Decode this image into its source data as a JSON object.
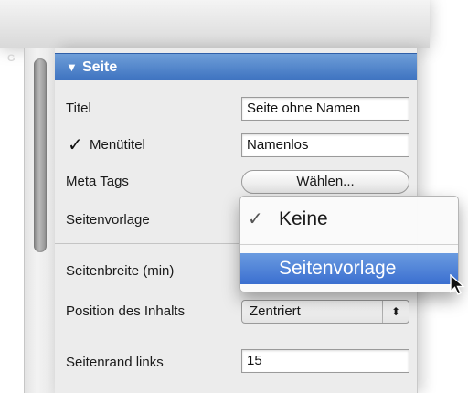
{
  "ghost_tab": "G",
  "section": {
    "title": "Seite",
    "toggle_icon": "disclosure-triangle-down"
  },
  "rows": {
    "titel_label": "Titel",
    "titel_value": "Seite ohne Namen",
    "menutitel_label": "Menütitel",
    "menutitel_checked": true,
    "menutitel_value": "Namenlos",
    "metatags_label": "Meta Tags",
    "metatags_button": "Wählen...",
    "seitenvorlage_label": "Seitenvorlage",
    "seitenbreite_label": "Seitenbreite (min)",
    "position_label": "Position des Inhalts",
    "position_value": "Zentriert",
    "seitenrand_label": "Seitenrand links",
    "seitenrand_value": "15"
  },
  "popup_menu": {
    "items": [
      {
        "label": "Keine",
        "checked": true
      },
      {
        "label": "Seitenvorlage",
        "highlighted": true
      }
    ]
  },
  "colors": {
    "header_blue": "#3f74c1",
    "selection_blue": "#3b6fd0"
  }
}
